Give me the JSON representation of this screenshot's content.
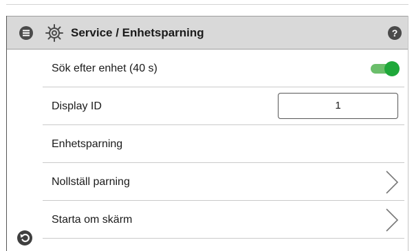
{
  "header": {
    "title": "Service / Enhetsparning",
    "menu_icon": "menu-icon",
    "settings_icon": "gear-icon",
    "help_icon": "help-icon",
    "help_glyph": "?"
  },
  "rows": [
    {
      "label": "Sök efter enhet (40 s)",
      "control": "toggle",
      "toggle_on": true,
      "toggle_color": "#1fa83a"
    },
    {
      "label": "Display ID",
      "control": "input",
      "value": "1"
    },
    {
      "label": "Enhetsparning",
      "control": "none"
    },
    {
      "label": "Nollställ parning",
      "control": "chevron",
      "icon": "chevron-right-icon"
    },
    {
      "label": "Starta om skärm",
      "control": "chevron",
      "icon": "chevron-right-icon"
    }
  ],
  "footer": {
    "back_icon": "back-icon"
  }
}
